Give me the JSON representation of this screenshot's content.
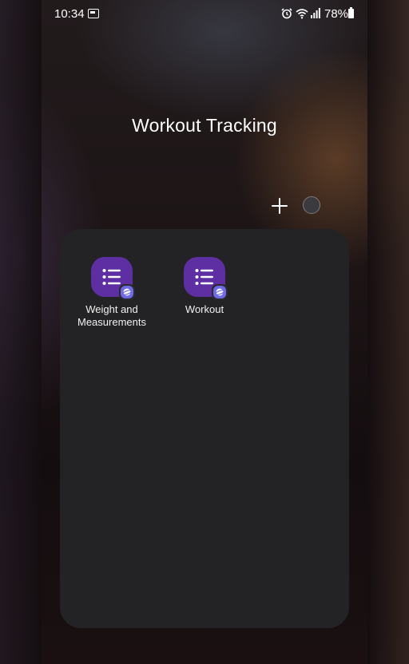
{
  "status_bar": {
    "time": "10:34",
    "battery_percent": "78%",
    "icons": [
      "notification-icon",
      "alarm-icon",
      "wifi-icon",
      "signal-icon",
      "battery-icon"
    ]
  },
  "folder": {
    "title": "Workout Tracking",
    "actions": {
      "add_icon": "plus-icon",
      "color_icon": "folder-color-icon"
    },
    "apps": [
      {
        "label": "Weight and\nMeasurements",
        "icon": "list-icon",
        "badge_icon": "browser-badge-icon"
      },
      {
        "label": "Workout",
        "icon": "list-icon",
        "badge_icon": "browser-badge-icon"
      }
    ]
  },
  "colors": {
    "app_icon": "#5d2fa3",
    "badge": "#6f6ae6",
    "panel": "#232224"
  }
}
